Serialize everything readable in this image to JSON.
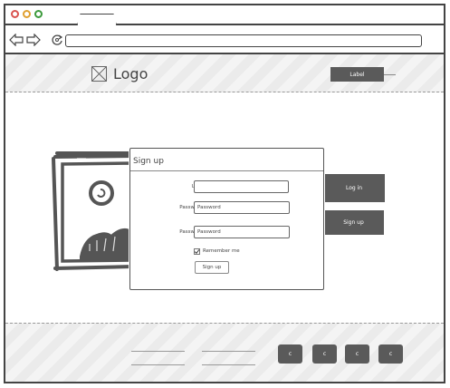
{
  "header": {
    "logo_text": "Logo",
    "button_label": "Label"
  },
  "signup": {
    "title": "Sign up",
    "user_label": "User",
    "user_value": "",
    "password_label": "Password",
    "password_value": "Password",
    "confirm_label": "Password",
    "confirm_value": "Password",
    "remember_label": "Remember me",
    "remember_checked": true,
    "submit_label": "Sign up"
  },
  "side_buttons": {
    "login_label": "Log in",
    "signup_label": "Sign up"
  },
  "footer": {
    "buttons": [
      "c",
      "c",
      "c",
      "c"
    ]
  },
  "colors": {
    "close": "#d9534f",
    "minimize": "#e0a030",
    "maximize": "#3c9a3c",
    "dark": "#5a5a5a"
  }
}
